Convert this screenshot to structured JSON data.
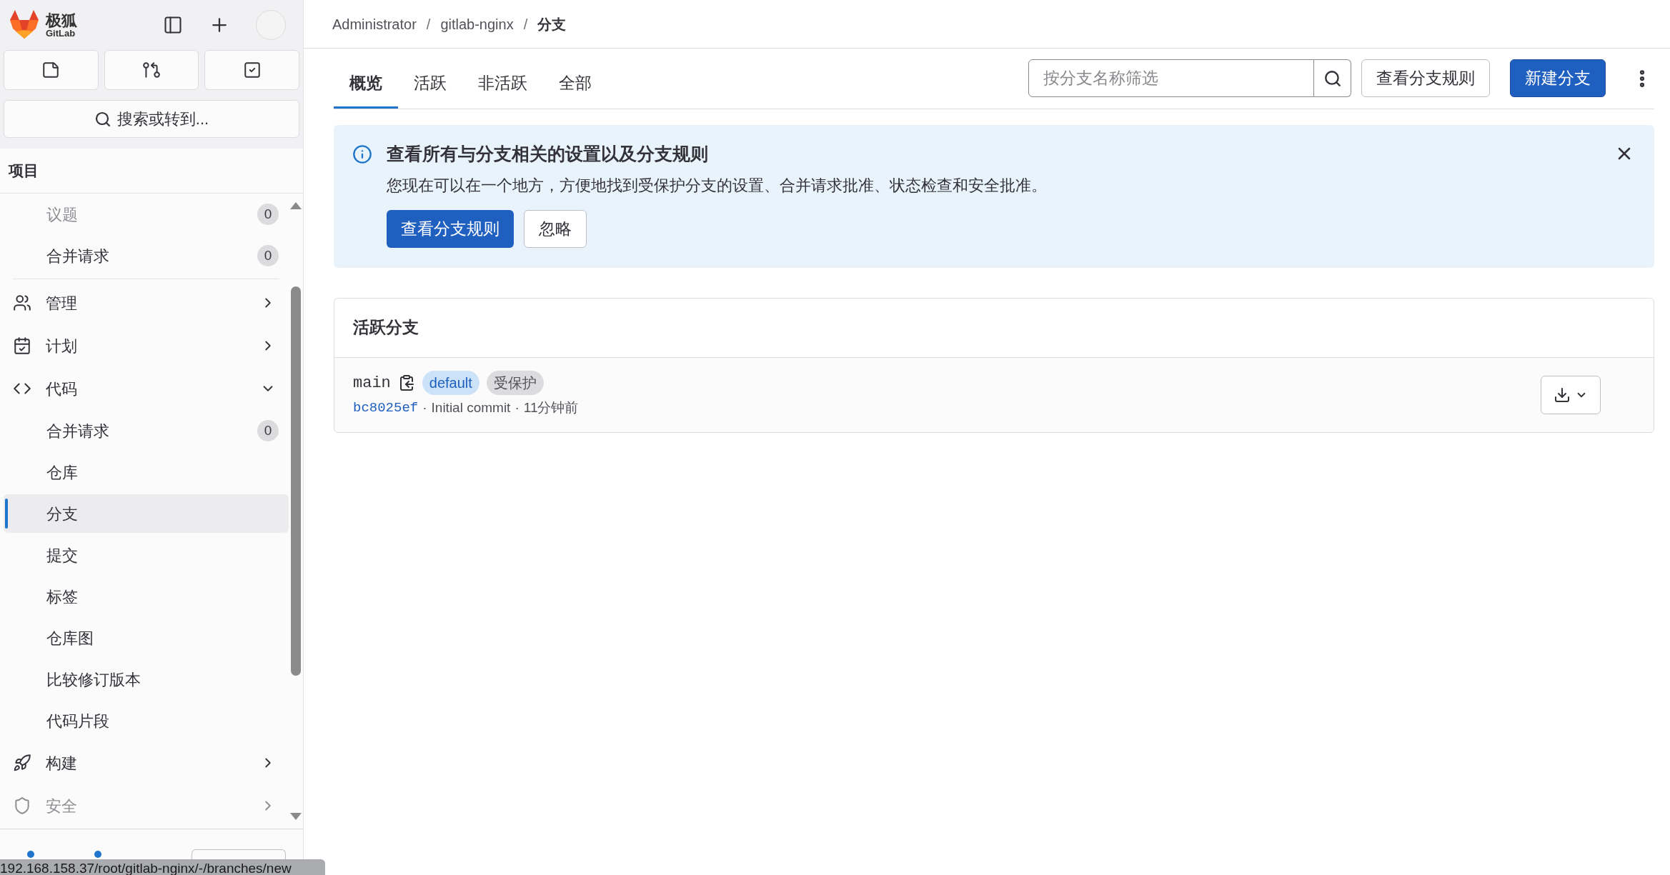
{
  "sidebar": {
    "logo_text": "极狐",
    "logo_sub": "GitLab",
    "search_label": "搜索或转到...",
    "section_title": "项目",
    "items": [
      {
        "label": "议题",
        "count": "0",
        "faded": true
      },
      {
        "label": "合并请求",
        "count": "0",
        "faded": false
      }
    ],
    "groups": [
      {
        "label": "管理",
        "expanded": false,
        "faded": false
      },
      {
        "label": "计划",
        "expanded": false,
        "faded": false
      },
      {
        "label": "代码",
        "expanded": true,
        "faded": false,
        "children": [
          {
            "label": "合并请求",
            "count": "0",
            "selected": false
          },
          {
            "label": "仓库",
            "selected": false
          },
          {
            "label": "分支",
            "selected": true
          },
          {
            "label": "提交",
            "selected": false
          },
          {
            "label": "标签",
            "selected": false
          },
          {
            "label": "仓库图",
            "selected": false
          },
          {
            "label": "比较修订版本",
            "selected": false
          },
          {
            "label": "代码片段",
            "selected": false
          }
        ]
      },
      {
        "label": "构建",
        "expanded": false,
        "faded": false
      },
      {
        "label": "安全",
        "expanded": false,
        "faded": true
      }
    ],
    "footer": [
      {
        "kind": "help"
      },
      {
        "kind": "support"
      },
      {
        "kind": "admin"
      }
    ]
  },
  "breadcrumbs": [
    "Administrator",
    "gitlab-nginx",
    "分支"
  ],
  "breadcrumb_separator": "/",
  "tabs": [
    {
      "label": "概览",
      "selected": true
    },
    {
      "label": "活跃",
      "selected": false
    },
    {
      "label": "非活跃",
      "selected": false
    },
    {
      "label": "全部",
      "selected": false
    }
  ],
  "filter": {
    "placeholder": "按分支名称筛选"
  },
  "buttons": {
    "rules": "查看分支规则",
    "new": "新建分支"
  },
  "alert": {
    "title": "查看所有与分支相关的设置以及分支规则",
    "body": "您现在可以在一个地方，方便地找到受保护分支的设置、合并请求批准、状态检查和安全批准。",
    "primary": "查看分支规则",
    "secondary": "忽略"
  },
  "card": {
    "title": "活跃分支",
    "separator": "·",
    "branches": [
      {
        "name": "main",
        "badges": [
          {
            "label": "default",
            "kind": "default"
          },
          {
            "label": "受保护",
            "kind": "protected"
          }
        ],
        "sha": "bc8025ef",
        "message": "Initial commit",
        "time": "11分钟前"
      }
    ]
  },
  "status_bar": "192.168.158.37/root/gitlab-nginx/-/branches/new"
}
